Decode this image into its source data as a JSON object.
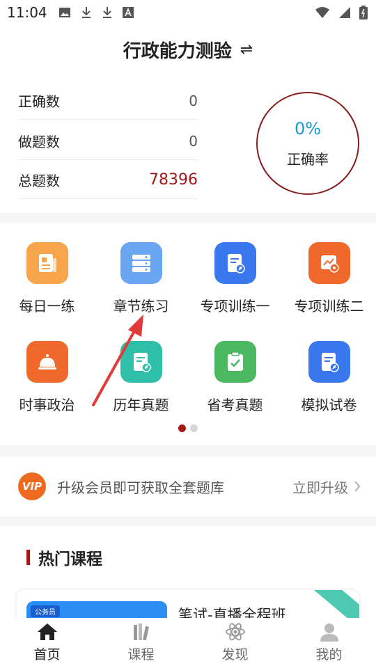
{
  "status_bar": {
    "time": "11:04"
  },
  "header": {
    "title": "行政能力测验",
    "switch_icon": "⇌"
  },
  "stats": {
    "rows": [
      {
        "label": "正确数",
        "value": "0"
      },
      {
        "label": "做题数",
        "value": "0"
      },
      {
        "label": "总题数",
        "value": "78396"
      }
    ],
    "accuracy_value": "0%",
    "accuracy_label": "正确率"
  },
  "grid": {
    "items": [
      {
        "label": "每日一练",
        "icon": "newspaper-icon",
        "color": "#f7a54a"
      },
      {
        "label": "章节练习",
        "icon": "server-list-icon",
        "color": "#6aa5f2"
      },
      {
        "label": "专项训练一",
        "icon": "document-compass-icon",
        "color": "#3a78ef"
      },
      {
        "label": "专项训练二",
        "icon": "chart-gear-icon",
        "color": "#f0692a"
      },
      {
        "label": "时事政治",
        "icon": "service-bell-icon",
        "color": "#f0692a"
      },
      {
        "label": "历年真题",
        "icon": "document-compass-icon",
        "color": "#2fbfa8"
      },
      {
        "label": "省考真题",
        "icon": "clipboard-check-icon",
        "color": "#4cb862"
      },
      {
        "label": "模拟试卷",
        "icon": "document-compass-icon",
        "color": "#3a78ef"
      }
    ],
    "page_count": 2,
    "active_page": 0
  },
  "vip": {
    "badge_text": "VIP",
    "text": "升级会员即可获取全套题库",
    "upgrade_label": "立即升级"
  },
  "hot_courses": {
    "title": "热门课程",
    "course": {
      "title": "笔试-直播全程班",
      "thumb_tag": "公务员"
    }
  },
  "tabs": [
    {
      "label": "首页",
      "icon": "home-icon"
    },
    {
      "label": "课程",
      "icon": "books-icon"
    },
    {
      "label": "发现",
      "icon": "atom-icon"
    },
    {
      "label": "我的",
      "icon": "person-icon"
    }
  ],
  "colors": {
    "accent_red": "#a01818",
    "accent_blue": "#1c97d6",
    "vip_orange": "#ee6a1f"
  }
}
